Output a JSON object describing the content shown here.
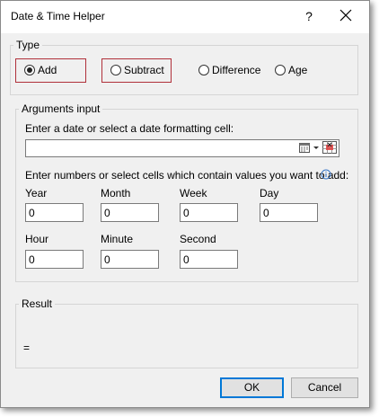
{
  "window": {
    "title": "Date & Time Helper",
    "help_glyph": "?",
    "close_icon": "close-icon"
  },
  "type_group": {
    "legend": "Type",
    "options": [
      {
        "label": "Add",
        "checked": true,
        "highlighted": true
      },
      {
        "label": "Subtract",
        "checked": false,
        "highlighted": true
      },
      {
        "label": "Difference",
        "checked": false,
        "highlighted": false
      },
      {
        "label": "Age",
        "checked": false,
        "highlighted": false
      }
    ]
  },
  "arguments": {
    "legend": "Arguments input",
    "date_prompt": "Enter a date or select a date formatting cell:",
    "date_value": "",
    "date_icons": [
      "calendar-icon",
      "dropdown-arrow-icon",
      "range-select-icon"
    ],
    "numbers_prompt": "Enter numbers or select cells which contain values you want to add:",
    "info_icon": "info-icon",
    "fields": {
      "year": {
        "label": "Year",
        "value": "0"
      },
      "month": {
        "label": "Month",
        "value": "0"
      },
      "week": {
        "label": "Week",
        "value": "0"
      },
      "day": {
        "label": "Day",
        "value": "0"
      },
      "hour": {
        "label": "Hour",
        "value": "0"
      },
      "minute": {
        "label": "Minute",
        "value": "0"
      },
      "second": {
        "label": "Second",
        "value": "0"
      }
    }
  },
  "result": {
    "legend": "Result",
    "value": "="
  },
  "buttons": {
    "ok": "OK",
    "cancel": "Cancel"
  },
  "colors": {
    "highlight": "#b0303a",
    "accent": "#0078d7"
  }
}
